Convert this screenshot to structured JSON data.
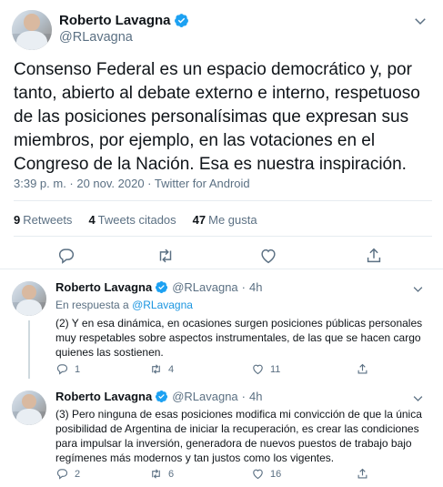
{
  "colors": {
    "accent": "#1da1f2",
    "muted": "#5b7083",
    "text": "#0f1419",
    "border": "#e6ecf0"
  },
  "main_tweet": {
    "author_name": "Roberto Lavagna",
    "handle": "@RLavagna",
    "text": "Consenso Federal es un espacio democrático y, por tanto, abierto al debate externo e interno, respetuoso de las posiciones personalísimas que expresan sus miembros, por ejemplo, en las votaciones en el Congreso de la Nación. Esa es nuestra inspiración.",
    "meta": "3:39 p. m. · 20 nov. 2020 · Twitter for Android",
    "stats": {
      "retweets_count": "9",
      "retweets_label": "Retweets",
      "quotes_count": "4",
      "quotes_label": "Tweets citados",
      "likes_count": "47",
      "likes_label": "Me gusta"
    },
    "icons": [
      "reply-icon",
      "retweet-icon",
      "like-icon",
      "share-icon"
    ]
  },
  "replies": [
    {
      "author_name": "Roberto Lavagna",
      "handle": "@RLavagna",
      "time": "4h",
      "reply_to_prefix": "En respuesta a",
      "reply_to_handle": "@RLavagna",
      "text": "(2) Y en esa dinámica, en ocasiones surgen posiciones públicas personales muy respetables sobre aspectos instrumentales, de las que se hacen cargo quienes las sostienen.",
      "replies_count": "1",
      "retweets_count": "4",
      "likes_count": "11"
    },
    {
      "author_name": "Roberto Lavagna",
      "handle": "@RLavagna",
      "time": "4h",
      "text": "(3) Pero ninguna de esas posiciones modifica mi convicción de que la única posibilidad de Argentina de iniciar la recuperación, es crear las condiciones para impulsar la inversión, generadora de nuevos puestos de trabajo bajo regímenes más modernos y tan justos como los vigentes.",
      "replies_count": "2",
      "retweets_count": "6",
      "likes_count": "16"
    }
  ]
}
